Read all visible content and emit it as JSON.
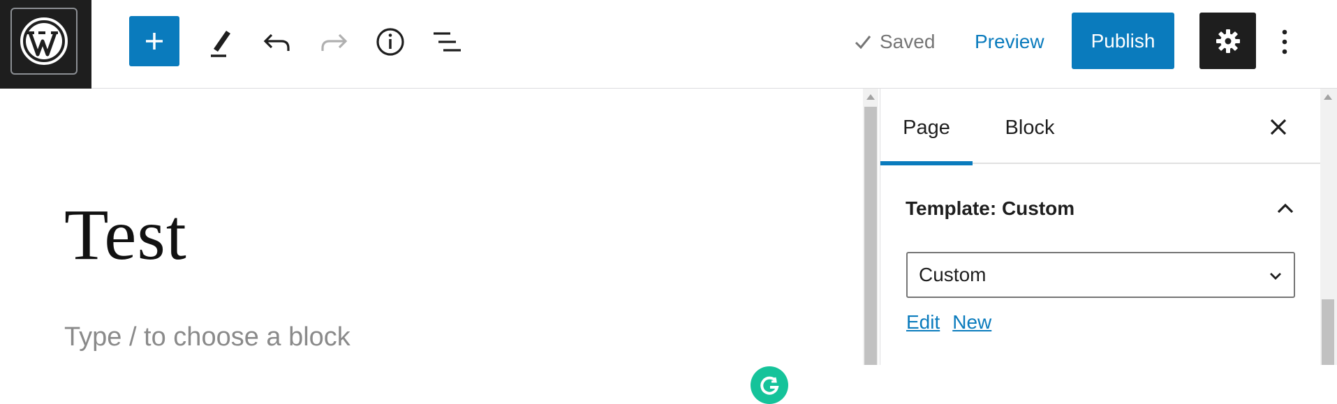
{
  "toolbar": {
    "saved_label": "Saved",
    "preview_label": "Preview",
    "publish_label": "Publish",
    "icons": [
      "wordpress-logo",
      "plus-icon",
      "pencil-icon",
      "undo-icon",
      "redo-icon",
      "info-icon",
      "list-view-icon",
      "check-icon",
      "gear-icon",
      "more-vertical-icon"
    ]
  },
  "editor": {
    "title": "Test",
    "placeholder": "Type / to choose a block"
  },
  "sidebar": {
    "tabs": [
      {
        "label": "Page",
        "active": true
      },
      {
        "label": "Block",
        "active": false
      }
    ],
    "panel": {
      "heading": "Template: Custom",
      "select_value": "Custom",
      "links": [
        "Edit",
        "New"
      ]
    }
  },
  "colors": {
    "accent": "#0a7bbd",
    "dark": "#1e1e1e",
    "grammarly": "#15c39a"
  }
}
